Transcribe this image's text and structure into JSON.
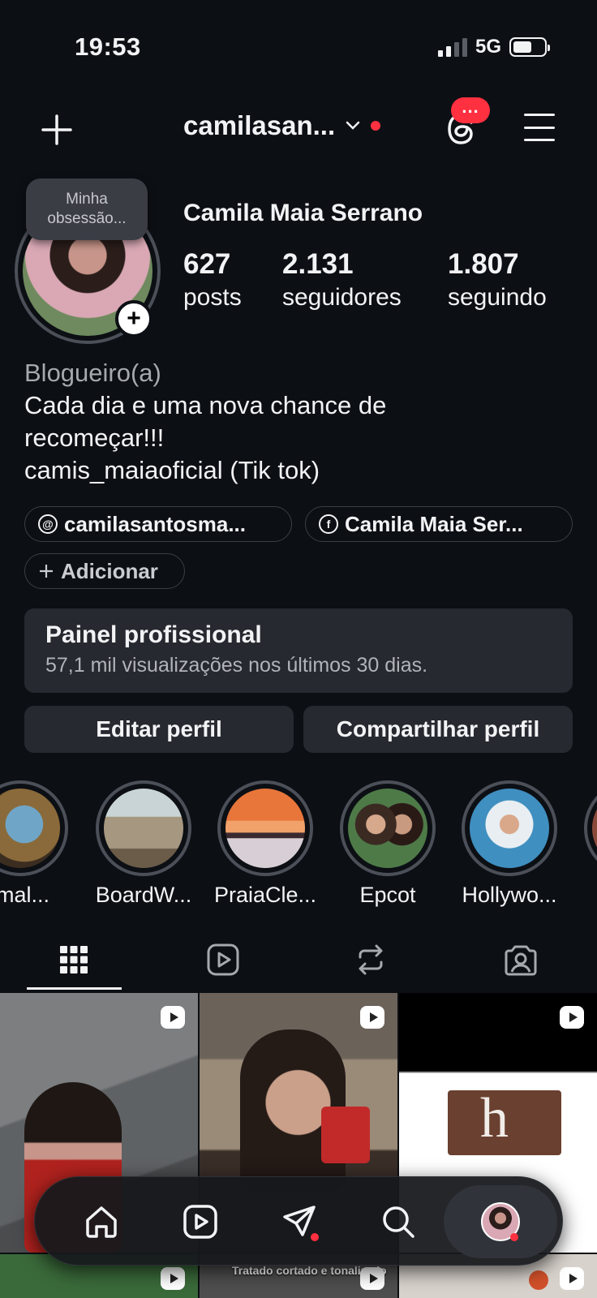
{
  "status_bar": {
    "time": "19:53",
    "network": "5G"
  },
  "header": {
    "username": "camilasan...",
    "threads_badge": "...",
    "icons": [
      "plus-icon",
      "chevron-down-icon",
      "threads-icon",
      "menu-icon"
    ]
  },
  "profile": {
    "note": "Minha obsessão...",
    "display_name": "Camila Maia Serrano",
    "stats": [
      {
        "value": "627",
        "label": "posts"
      },
      {
        "value": "2.131",
        "label": "seguidores"
      },
      {
        "value": "1.807",
        "label": "seguindo"
      }
    ],
    "category": "Blogueiro(a)",
    "bio_lines": [
      "Cada dia e uma nova chance de",
      "recomeçar!!!",
      "camis_maiaoficial (Tik tok)"
    ],
    "links": [
      {
        "icon": "threads-icon",
        "label": "camilasantosma..."
      },
      {
        "icon": "facebook-icon",
        "label": "Camila Maia Ser..."
      }
    ],
    "add_link": "Adicionar"
  },
  "dashboard": {
    "title": "Painel profissional",
    "subtitle": "57,1 mil visualizações nos últimos 30 dias."
  },
  "actions": {
    "edit": "Editar perfil",
    "share": "Compartilhar perfil"
  },
  "highlights": [
    "imal...",
    "BoardW...",
    "PraiaCle...",
    "Epcot",
    "Hollywo..."
  ],
  "tabs": [
    "grid-icon",
    "reels-icon",
    "reposts-icon",
    "tagged-icon"
  ],
  "grid": {
    "caption": "Tratado cortado e tonalizado"
  },
  "nav": [
    "home-icon",
    "reels-icon",
    "direct-icon",
    "search-icon",
    "profile-avatar"
  ],
  "colors": {
    "background": "#0c0f14",
    "surface": "#26292f",
    "notification": "#ff3040"
  }
}
